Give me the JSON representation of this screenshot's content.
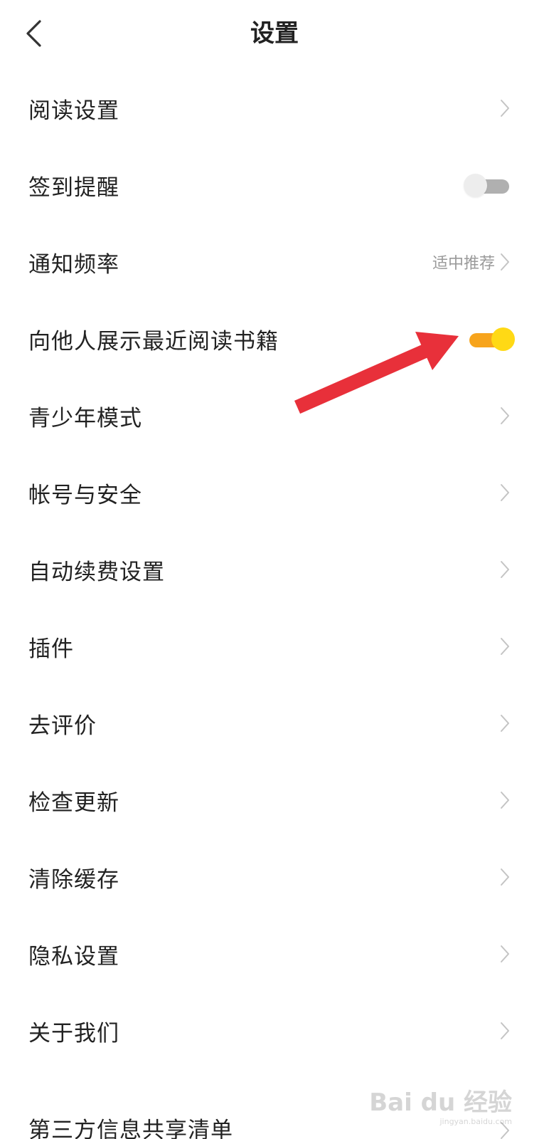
{
  "header": {
    "title": "设置"
  },
  "settings": [
    {
      "label": "阅读设置",
      "control": "chevron"
    },
    {
      "label": "签到提醒",
      "control": "toggle",
      "state": "off"
    },
    {
      "label": "通知频率",
      "control": "value",
      "value": "适中推荐"
    },
    {
      "label": "向他人展示最近阅读书籍",
      "control": "toggle",
      "state": "on"
    },
    {
      "label": "青少年模式",
      "control": "chevron"
    },
    {
      "label": "帐号与安全",
      "control": "chevron"
    },
    {
      "label": "自动续费设置",
      "control": "chevron"
    },
    {
      "label": "插件",
      "control": "chevron"
    },
    {
      "label": "去评价",
      "control": "chevron"
    },
    {
      "label": "检查更新",
      "control": "chevron"
    },
    {
      "label": "清除缓存",
      "control": "chevron"
    },
    {
      "label": "隐私设置",
      "control": "chevron"
    },
    {
      "label": "关于我们",
      "control": "chevron"
    },
    {
      "label": "第三方信息共享清单",
      "control": "chevron"
    }
  ],
  "watermark": {
    "brand": "Bai du 经验",
    "url": "jingyan.baidu.com"
  },
  "colors": {
    "toggle_on_track": "#f7a41c",
    "toggle_on_knob": "#ffd915",
    "toggle_off_track": "#b0b0b0",
    "toggle_off_knob": "#ededed",
    "annotation_arrow": "#e8303a"
  }
}
